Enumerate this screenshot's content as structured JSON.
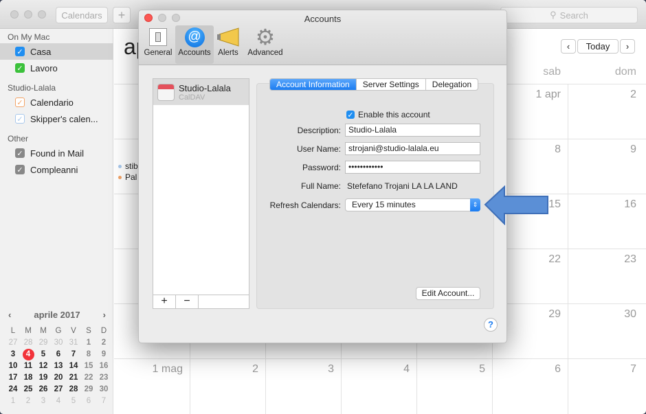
{
  "calendar_window": {
    "toolbar": {
      "calendars_label": "Calendars",
      "add_label": "+",
      "search_placeholder": "Search"
    },
    "sidebar": {
      "sections": [
        {
          "title": "On My Mac",
          "items": [
            {
              "label": "Casa",
              "color": "#1f8ef1",
              "selected": true
            },
            {
              "label": "Lavoro",
              "color": "#3bc13b"
            }
          ]
        },
        {
          "title": "Studio-Lalala",
          "items": [
            {
              "label": "Calendario",
              "color": "#f3a366"
            },
            {
              "label": "Skipper's calen...",
              "color": "#a8c8ec"
            }
          ]
        },
        {
          "title": "Other",
          "items": [
            {
              "label": "Found in Mail",
              "color": "#888888"
            },
            {
              "label": "Compleanni",
              "color": "#888888"
            }
          ]
        }
      ]
    },
    "mini_calendar": {
      "title": "aprile 2017",
      "prev": "‹",
      "next": "›",
      "weekdays": [
        "L",
        "M",
        "M",
        "G",
        "V",
        "S",
        "D"
      ],
      "weeks": [
        [
          "27",
          "28",
          "29",
          "30",
          "31",
          "1",
          "2"
        ],
        [
          "3",
          "4",
          "5",
          "6",
          "7",
          "8",
          "9"
        ],
        [
          "10",
          "11",
          "12",
          "13",
          "14",
          "15",
          "16"
        ],
        [
          "17",
          "18",
          "19",
          "20",
          "21",
          "22",
          "23"
        ],
        [
          "24",
          "25",
          "26",
          "27",
          "28",
          "29",
          "30"
        ],
        [
          "1",
          "2",
          "3",
          "4",
          "5",
          "6",
          "7"
        ]
      ],
      "today": "4"
    },
    "month_view": {
      "title_partial": "ap",
      "today_label": "Today",
      "prev": "‹",
      "next": "›",
      "weekday_headers": [
        "sab",
        "dom"
      ],
      "days": {
        "sab": [
          "1 apr",
          "8",
          "15",
          "22",
          "29",
          "6"
        ],
        "dom": [
          "2",
          "9",
          "16",
          "23",
          "30",
          "7"
        ]
      },
      "last_row": [
        "1 mag",
        "2",
        "3",
        "4",
        "5",
        "6",
        "7"
      ],
      "events": [
        {
          "label": "stib",
          "color": "#a8c8ec"
        },
        {
          "label": "Pal",
          "color": "#f3a366"
        }
      ]
    }
  },
  "accounts_dialog": {
    "title": "Accounts",
    "toolbar": [
      {
        "label": "General",
        "icon": "switch-icon"
      },
      {
        "label": "Accounts",
        "icon": "at-icon",
        "selected": true
      },
      {
        "label": "Alerts",
        "icon": "megaphone-icon"
      },
      {
        "label": "Advanced",
        "icon": "gear-icon"
      }
    ],
    "accounts_list": [
      {
        "name": "Studio-Lalala",
        "type": "CalDAV"
      }
    ],
    "list_buttons": {
      "add": "+",
      "remove": "−"
    },
    "tabs": [
      {
        "label": "Account Information",
        "active": true
      },
      {
        "label": "Server Settings"
      },
      {
        "label": "Delegation"
      }
    ],
    "form": {
      "enable_label": "Enable this account",
      "enable_checked": true,
      "description_label": "Description:",
      "description_value": "Studio-Lalala",
      "username_label": "User Name:",
      "username_value": "strojani@studio-lalala.eu",
      "password_label": "Password:",
      "password_value": "••••••••••••",
      "fullname_label": "Full Name:",
      "fullname_value": "Stefefano Trojani LA LA LAND",
      "refresh_label": "Refresh Calendars:",
      "refresh_value": "Every 15 minutes"
    },
    "edit_button": "Edit Account...",
    "help": "?",
    "accent": "#1b7cf1"
  },
  "annotation": {
    "arrow_color": "#5b8fd6"
  }
}
